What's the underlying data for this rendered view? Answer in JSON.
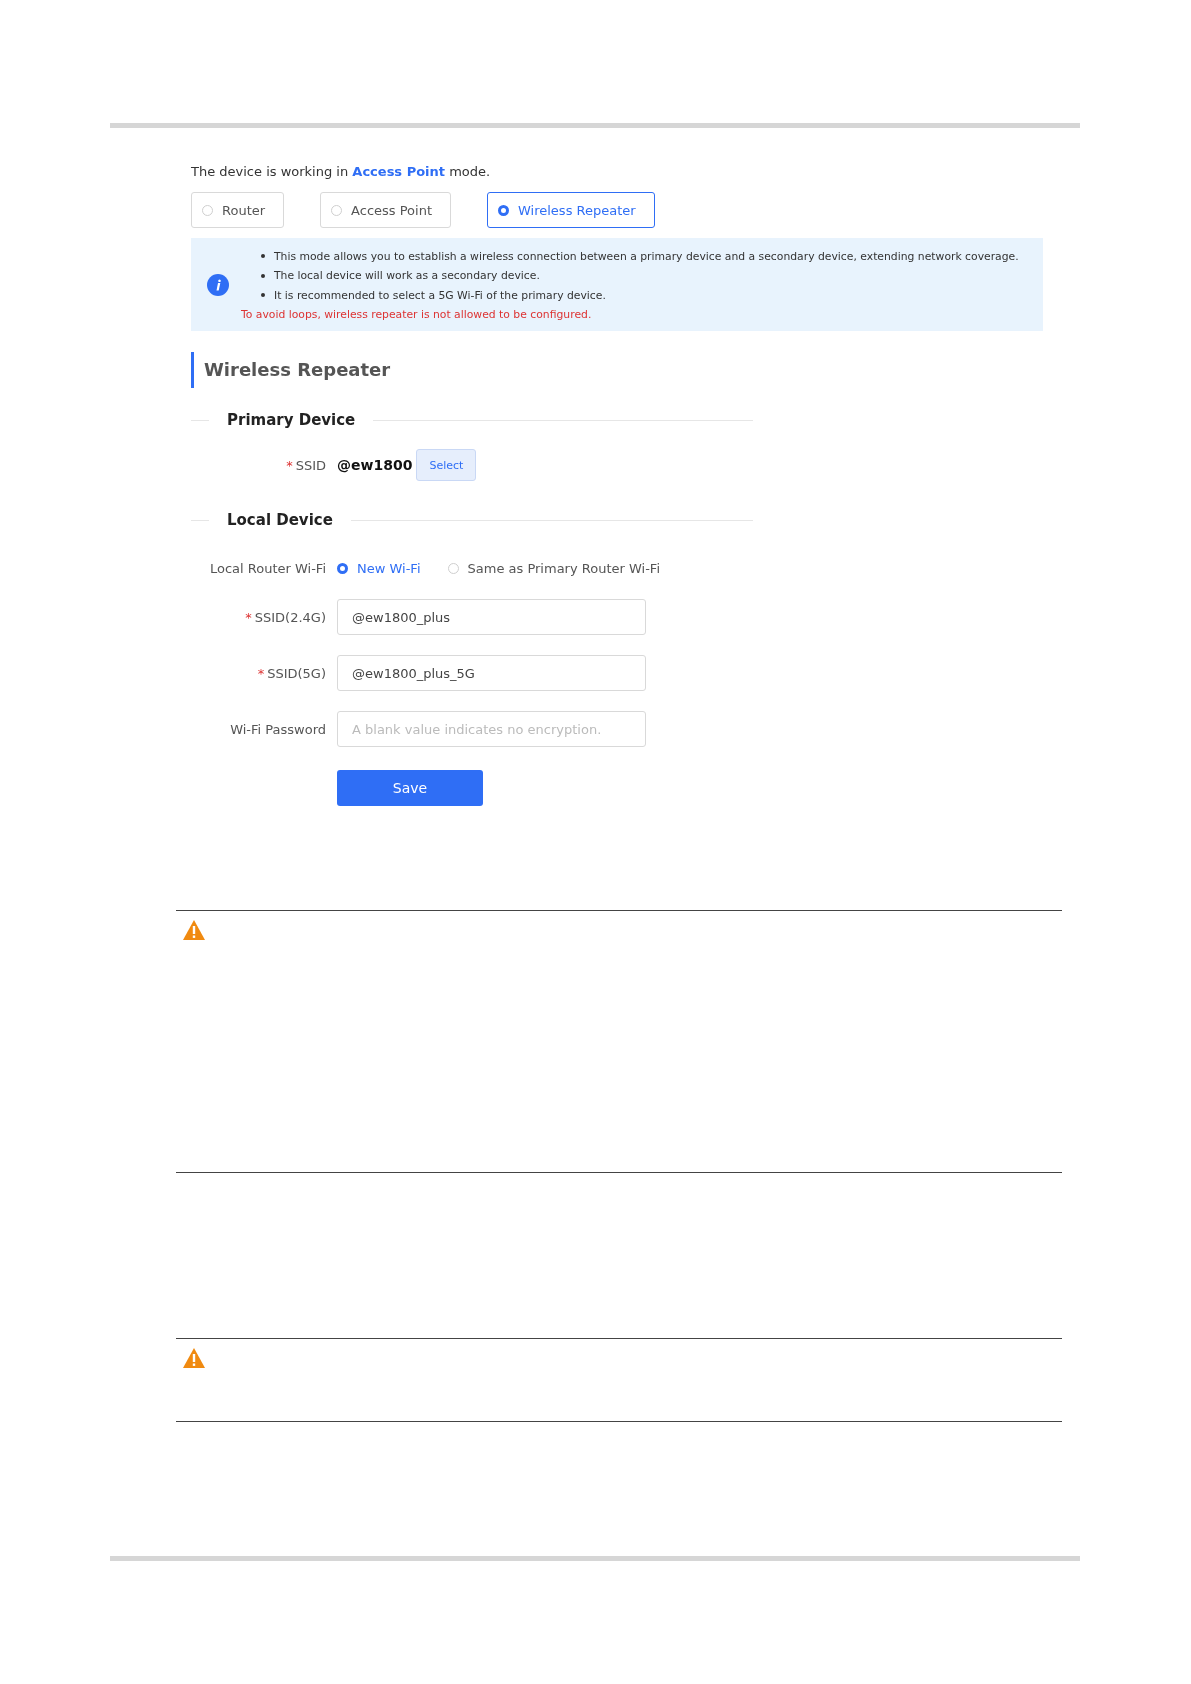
{
  "intro": "The device is working in **Access Point** mode.",
  "modes": [
    {
      "label": "Router",
      "selected": false
    },
    {
      "label": "Access Point",
      "selected": false
    },
    {
      "label": "Wireless Repeater",
      "selected": true
    }
  ],
  "notice": {
    "items": [
      "This mode allows you to establish a wireless connection between a primary device and a secondary device, extending network coverage.",
      "The local device will work as a secondary device.",
      "It is recommended to select a 5G Wi-Fi of the primary device."
    ],
    "warning": "To avoid loops, wireless repeater is not allowed to be configured."
  },
  "section_title": "Wireless Repeater",
  "primary": {
    "title": "Primary Device",
    "mark": "*",
    "ssid_label": "SSID",
    "ssid_value": "@ew1800",
    "select_button": "Select"
  },
  "local": {
    "title": "Local Device",
    "wifi_label": "Local Router Wi-Fi",
    "options": [
      {
        "label": "New Wi-Fi",
        "selected": true
      },
      {
        "label": "Same as Primary Router Wi-Fi",
        "selected": false
      }
    ],
    "fields": [
      {
        "mark": "*",
        "label": "SSID(2.4G)",
        "value": "@ew1800_plus"
      },
      {
        "mark": "*",
        "label": "SSID(5G)",
        "value": "@ew1800_plus_5G"
      },
      {
        "label": "Wi-Fi Password",
        "placeholder": "A blank value indicates no encryption."
      }
    ],
    "save_button": "Save"
  }
}
